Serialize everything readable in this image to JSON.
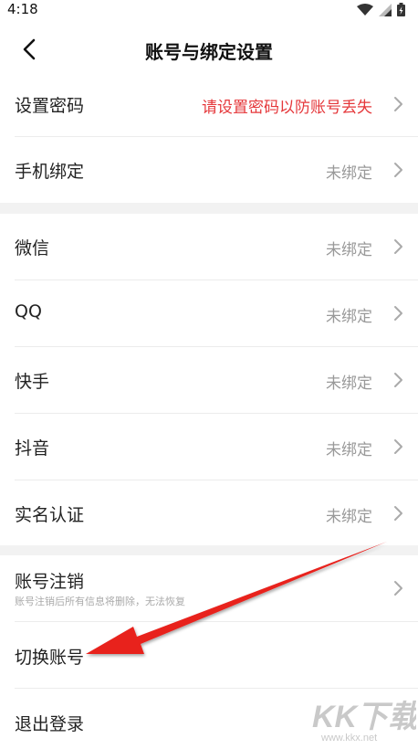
{
  "status": {
    "time": "4:18"
  },
  "header": {
    "title": "账号与绑定设置",
    "back_icon": "chevron-left-icon"
  },
  "rows": [
    {
      "label": "设置密码",
      "value": "请设置密码以防账号丢失"
    },
    {
      "label": "手机绑定",
      "value": "未绑定"
    },
    {
      "label": "微信",
      "value": "未绑定"
    },
    {
      "label": "QQ",
      "value": "未绑定"
    },
    {
      "label": "快手",
      "value": "未绑定"
    },
    {
      "label": "抖音",
      "value": "未绑定"
    },
    {
      "label": "实名认证",
      "value": "未绑定"
    }
  ],
  "account": {
    "deregister_label": "账号注销",
    "deregister_sub": "账号注销后所有信息将删除，无法恢复",
    "switch_label": "切换账号",
    "logout_label": "退出登录"
  },
  "colors": {
    "accent_red": "#e5383b",
    "muted": "#999999",
    "gap_bg": "#f2f2f2"
  },
  "watermark": {
    "main": "KK下载",
    "url": "www.kkx.net"
  }
}
